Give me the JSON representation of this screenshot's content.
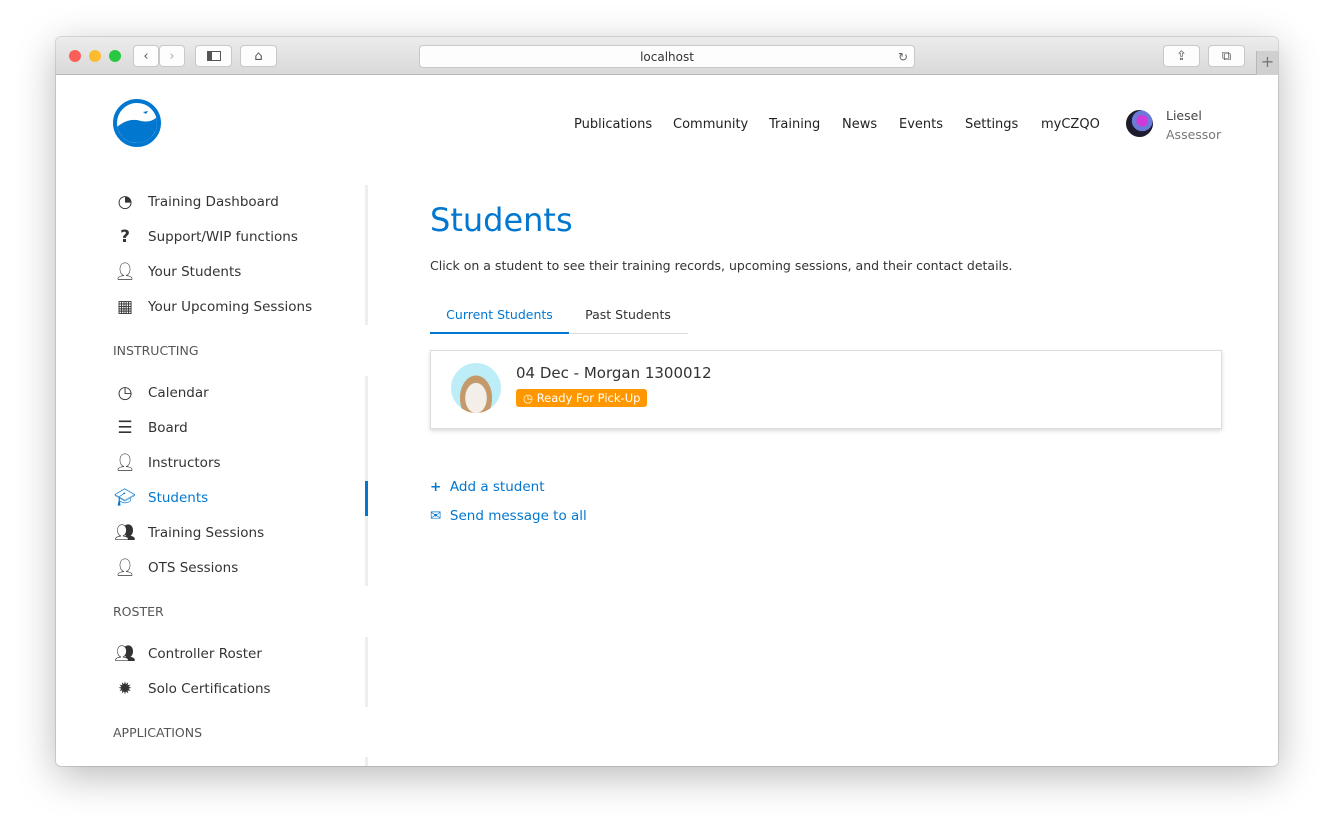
{
  "browser": {
    "url": "localhost"
  },
  "header": {
    "nav": [
      "Publications",
      "Community",
      "Training",
      "News",
      "Events",
      "Settings",
      "myCZQO"
    ],
    "user": {
      "name": "Liesel",
      "role": "Assessor"
    }
  },
  "sidebar": {
    "top": [
      {
        "label": "Training Dashboard",
        "icon": "dashboard-icon"
      },
      {
        "label": "Support/WIP functions",
        "icon": "question-icon"
      },
      {
        "label": "Your Students",
        "icon": "user-icon"
      },
      {
        "label": "Your Upcoming Sessions",
        "icon": "calendar-icon"
      }
    ],
    "instructing_title": "INSTRUCTING",
    "instructing": [
      {
        "label": "Calendar"
      },
      {
        "label": "Board"
      },
      {
        "label": "Instructors"
      },
      {
        "label": "Students"
      },
      {
        "label": "Training Sessions"
      },
      {
        "label": "OTS Sessions"
      }
    ],
    "roster_title": "ROSTER",
    "roster": [
      {
        "label": "Controller Roster"
      },
      {
        "label": "Solo Certifications"
      }
    ],
    "applications_title": "APPLICATIONS"
  },
  "main": {
    "title": "Students",
    "description": "Click on a student to see their training records, upcoming sessions, and their contact details.",
    "tabs": [
      "Current Students",
      "Past Students"
    ],
    "students": [
      {
        "name": "04 Dec - Morgan 1300012",
        "status": "Ready For Pick-Up",
        "status_color": "#ff9800"
      }
    ],
    "add_student": "Add a student",
    "send_message": "Send message to all"
  },
  "colors": {
    "accent": "#0277d0"
  }
}
